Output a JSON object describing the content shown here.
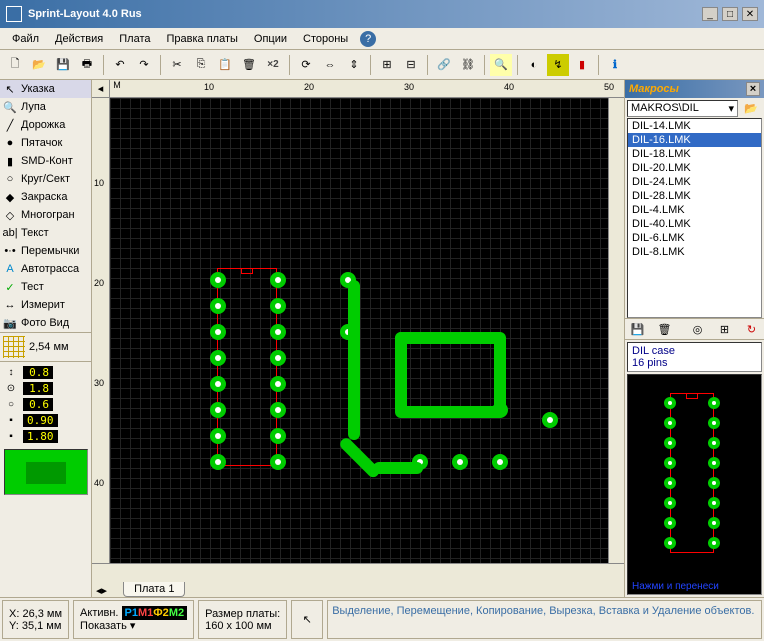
{
  "title": "Sprint-Layout 4.0 Rus",
  "menu": [
    "Файл",
    "Действия",
    "Плата",
    "Правка платы",
    "Опции",
    "Стороны"
  ],
  "tools": [
    {
      "icon": "↖",
      "label": "Указка",
      "sel": true
    },
    {
      "icon": "🔍",
      "label": "Лупа"
    },
    {
      "icon": "╱",
      "label": "Дорожка"
    },
    {
      "icon": "●",
      "label": "Пятачок"
    },
    {
      "icon": "▮",
      "label": "SMD-Конт"
    },
    {
      "icon": "○",
      "label": "Круг/Сект"
    },
    {
      "icon": "◆",
      "label": "Закраска"
    },
    {
      "icon": "◇",
      "label": "Многогран"
    },
    {
      "icon": "ab|",
      "label": "Текст"
    },
    {
      "icon": "•·•",
      "label": "Перемычки"
    },
    {
      "icon": "A",
      "label": "Автотрасса",
      "color": "#08c"
    },
    {
      "icon": "✓",
      "label": "Тест",
      "color": "#0a0"
    },
    {
      "icon": "↔",
      "label": "Измерит"
    },
    {
      "icon": "📷",
      "label": "Фото Вид"
    }
  ],
  "grid_label": "2,54 мм",
  "sizes": [
    {
      "icn": "↕",
      "val": "0.8"
    },
    {
      "icn": "⊙",
      "val": "1.8"
    },
    {
      "icn": "○",
      "val": "0.6"
    },
    {
      "icn": "▪",
      "val": "0.90"
    },
    {
      "icn": "▪",
      "val": "1.80"
    }
  ],
  "ruler_h": [
    "10",
    "20",
    "30",
    "40",
    "50"
  ],
  "ruler_v": [
    "10",
    "20",
    "30",
    "40"
  ],
  "tab": "Плата 1",
  "makros": {
    "title": "Макросы",
    "path": "MAKROS\\DIL",
    "items": [
      "DIL-14.LMK",
      "DIL-16.LMK",
      "DIL-18.LMK",
      "DIL-20.LMK",
      "DIL-24.LMK",
      "DIL-28.LMK",
      "DIL-4.LMK",
      "DIL-40.LMK",
      "DIL-6.LMK",
      "DIL-8.LMK"
    ],
    "selected": "DIL-16.LMK",
    "info1": "DIL case",
    "info2": "16 pins",
    "hint": "Нажми и перенеси"
  },
  "status": {
    "x": "X: 26,3 мм",
    "y": "Y: 35,1 мм",
    "active": "Активн.",
    "show": "Показать",
    "boardsize_lbl": "Размер платы:",
    "boardsize": "160 x 100 мм",
    "hint": "Выделение, Перемещение, Копирование, Вырезка, Вставка и Удаление объектов."
  }
}
